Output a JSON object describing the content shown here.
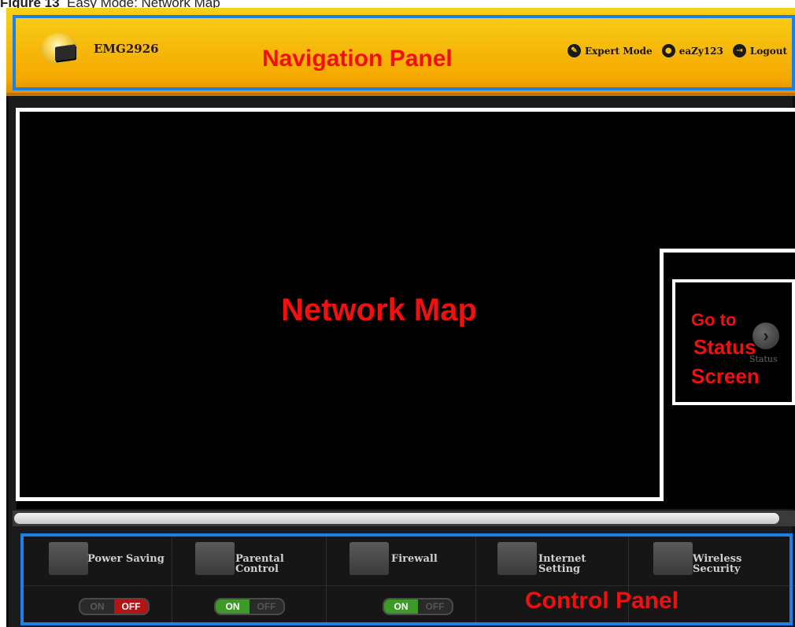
{
  "caption": {
    "figure": "Figure 13",
    "title": "Easy Mode: Network Map"
  },
  "header": {
    "model": "EMG2926",
    "links": [
      {
        "label": "Expert Mode",
        "icon": "wrench-icon"
      },
      {
        "label": "eaZy123",
        "icon": "user-icon"
      },
      {
        "label": "Logout",
        "icon": "logout-icon"
      }
    ]
  },
  "annotations": {
    "navigation_panel": "Navigation Panel",
    "network_map": "Network Map",
    "go_to": "Go to",
    "status": "Status",
    "screen": "Screen",
    "control_panel": "Control Panel"
  },
  "map": {
    "status_label": "Status"
  },
  "control_panel": {
    "items": [
      {
        "label_line1": "Power Saving",
        "label_line2": "",
        "icon": "leaf-icon",
        "on": "ON",
        "off": "OFF",
        "state": "off"
      },
      {
        "label_line1": "Parental",
        "label_line2": "Control",
        "icon": "parental-control-icon",
        "on": "ON",
        "off": "OFF",
        "state": "on"
      },
      {
        "label_line1": "Firewall",
        "label_line2": "",
        "icon": "firewall-icon",
        "on": "ON",
        "off": "OFF",
        "state": "on"
      },
      {
        "label_line1": "Internet",
        "label_line2": "Setting",
        "icon": "signal-bars-icon"
      },
      {
        "label_line1": "Wireless",
        "label_line2": "Security",
        "icon": "wireless-icon"
      }
    ]
  },
  "colors": {
    "annotation_red": "#f20f0f",
    "outline_blue": "#1f7fe6",
    "header_yellow": "#f5b800"
  }
}
